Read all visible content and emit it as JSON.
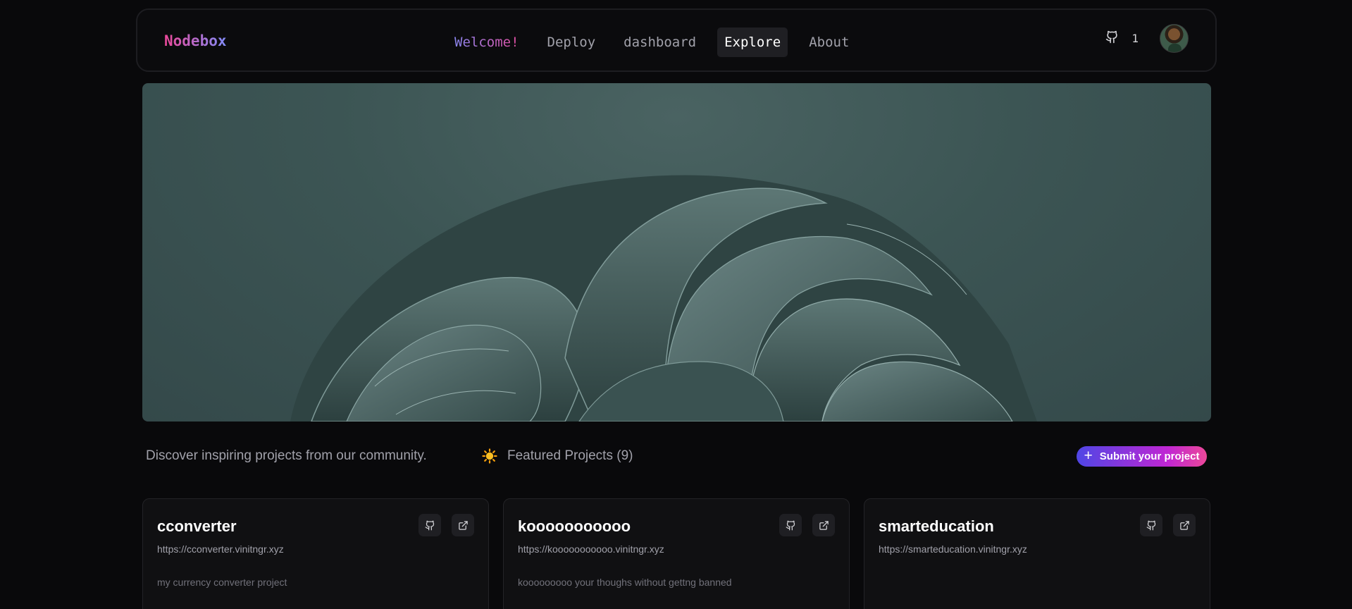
{
  "brand": "Nodebox",
  "nav": {
    "links": [
      {
        "label": "Welcome!"
      },
      {
        "label": "Deploy"
      },
      {
        "label": "dashboard"
      },
      {
        "label": "Explore",
        "active": true
      },
      {
        "label": "About"
      }
    ],
    "github_count": "1",
    "github_icon": "github-icon"
  },
  "hero": {
    "image": "abstract-fabric-waves"
  },
  "intro": {
    "tagline": "Discover inspiring projects from our community.",
    "featured_icon": "sun-emoji",
    "featured_label": "Featured Projects (9)"
  },
  "submit": {
    "label": "Submit your project",
    "icon": "plus-icon"
  },
  "projects": [
    {
      "title": "cconverter",
      "url": "https://cconverter.vinitngr.xyz",
      "description": "my currency converter project"
    },
    {
      "title": "kooooooooooo",
      "url": "https://kooooooooooo.vinitngr.xyz",
      "description": "kooooooooo your thoughs without gettng banned"
    },
    {
      "title": "smarteducation",
      "url": "https://smarteducation.vinitngr.xyz",
      "description": ""
    }
  ],
  "colors": {
    "background": "#09090b",
    "brand_gradient_start": "#ec4899",
    "brand_gradient_end": "#818cf8",
    "submit_gradient_start": "#4f46e5",
    "submit_gradient_end": "#ec4899",
    "card_bg": "#101012"
  }
}
